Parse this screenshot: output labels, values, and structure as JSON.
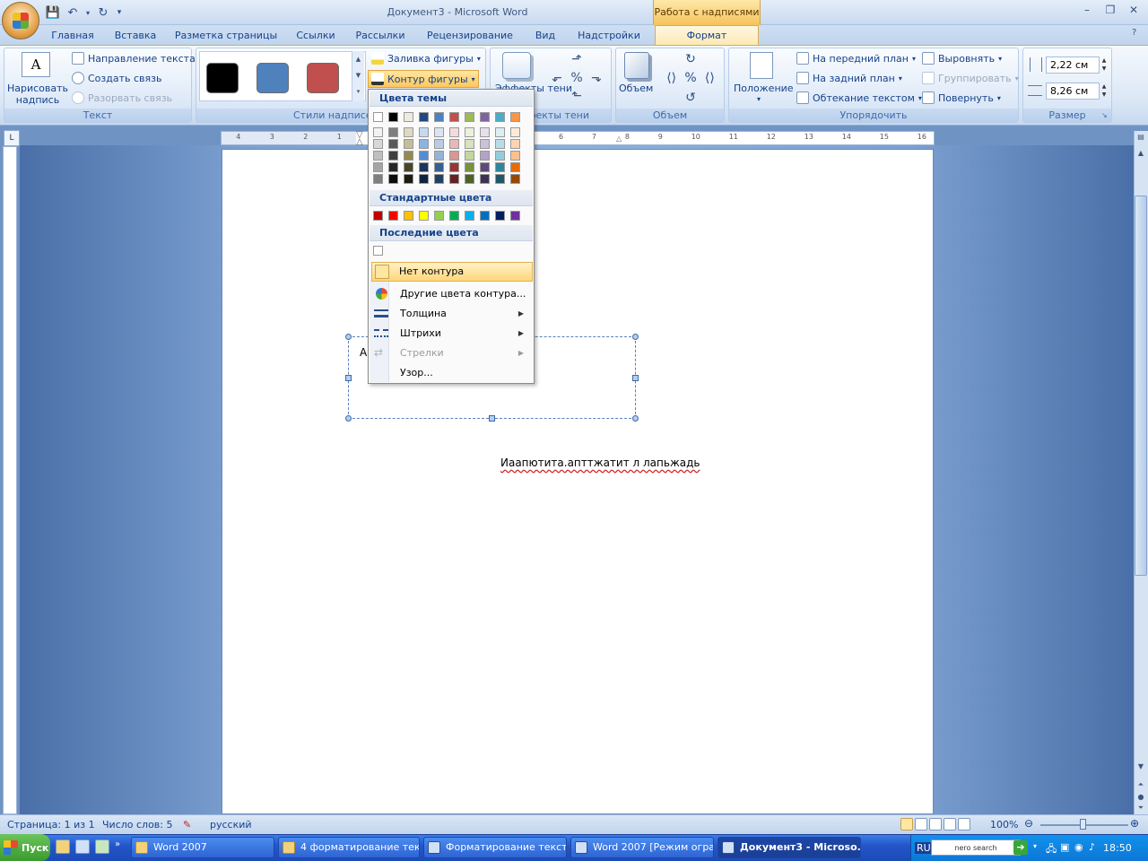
{
  "window": {
    "title": "Документ3 - Microsoft Word",
    "context_tab_header": "Работа с надписями",
    "controls": [
      "–",
      "❐",
      "✕"
    ]
  },
  "tabs": [
    "Главная",
    "Вставка",
    "Разметка страницы",
    "Ссылки",
    "Рассылки",
    "Рецензирование",
    "Вид",
    "Надстройки"
  ],
  "active_tab": "Формат",
  "ribbon": {
    "text_group": {
      "title": "Текст",
      "draw_label": "Нарисовать надпись",
      "direction": "Направление текста",
      "create_link": "Создать связь",
      "break_link": "Разорвать связь"
    },
    "styles_group": {
      "title": "Стили надписей",
      "fill": "Заливка фигуры",
      "outline": "Контур фигуры",
      "swatches": [
        "#000000",
        "#4f81bd",
        "#c0504d"
      ]
    },
    "shadow_group": {
      "title": "Эффекты тени",
      "button": "Эффекты тени"
    },
    "volume_group": {
      "title": "Объем",
      "button": "Объем"
    },
    "arrange_group": {
      "title": "Упорядочить",
      "position": "Положение",
      "bring_front": "На передний план",
      "send_back": "На задний план",
      "wrap": "Обтекание текстом",
      "align": "Выровнять",
      "group": "Группировать",
      "rotate": "Повернуть"
    },
    "size_group": {
      "title": "Размер",
      "height": "2,22 см",
      "width": "8,26 см"
    }
  },
  "ruler": {
    "left_numbers": [
      "4",
      "3",
      "2",
      "1"
    ],
    "right_numbers": [
      "6",
      "7",
      "8",
      "9",
      "10",
      "11",
      "12",
      "13",
      "14",
      "15",
      "16"
    ],
    "corner": "L"
  },
  "document": {
    "textbox_text": "А",
    "body_text": "Иаапютита.апттжатит л лапьжадь"
  },
  "dropdown": {
    "theme_colors_title": "Цвета темы",
    "standard_colors_title": "Стандартные цвета",
    "recent_colors_title": "Последние цвета",
    "theme_top": [
      "#ffffff",
      "#000000",
      "#eeece1",
      "#1f497d",
      "#4f81bd",
      "#c0504d",
      "#9bbb59",
      "#8064a2",
      "#4bacc6",
      "#f79646"
    ],
    "theme_shades": [
      [
        "#f2f2f2",
        "#d8d8d8",
        "#bfbfbf",
        "#a5a5a5",
        "#7f7f7f"
      ],
      [
        "#7f7f7f",
        "#595959",
        "#3f3f3f",
        "#262626",
        "#0c0c0c"
      ],
      [
        "#ddd9c3",
        "#c4bd97",
        "#938953",
        "#494429",
        "#1d1b10"
      ],
      [
        "#c6d9f0",
        "#8db3e2",
        "#548dd4",
        "#17365d",
        "#0f243e"
      ],
      [
        "#dbe5f1",
        "#b8cce4",
        "#95b3d7",
        "#366092",
        "#244061"
      ],
      [
        "#f2dcdb",
        "#e5b9b7",
        "#d99694",
        "#953734",
        "#632423"
      ],
      [
        "#ebf1dd",
        "#d7e3bc",
        "#c3d69b",
        "#76923c",
        "#4f6128"
      ],
      [
        "#e5e0ec",
        "#ccc1d9",
        "#b2a2c7",
        "#5f497a",
        "#3f3151"
      ],
      [
        "#dbeef3",
        "#b7dde8",
        "#92cddc",
        "#31859b",
        "#205867"
      ],
      [
        "#fdeada",
        "#fbd5b5",
        "#fac08f",
        "#e36c09",
        "#974806"
      ]
    ],
    "standard": [
      "#c00000",
      "#ff0000",
      "#ffc000",
      "#ffff00",
      "#92d050",
      "#00b050",
      "#00b0f0",
      "#0070c0",
      "#002060",
      "#7030a0"
    ],
    "recent": [
      "#ffffff"
    ],
    "no_outline": "Нет контура",
    "more_colors": "Другие цвета контура...",
    "weight": "Толщина",
    "dashes": "Штрихи",
    "arrows": "Стрелки",
    "pattern": "Узор..."
  },
  "status": {
    "page": "Страница: 1 из 1",
    "words": "Число слов: 5",
    "language": "русский",
    "zoom": "100%"
  },
  "taskbar": {
    "start": "Пуск",
    "items": [
      "Word 2007",
      "4 форматирование тек...",
      "Форматирование текст...",
      "Word 2007 [Режим огра...",
      "Документ3 - Microso..."
    ],
    "lang": "RU",
    "search": "nero search",
    "time": "18:50"
  }
}
